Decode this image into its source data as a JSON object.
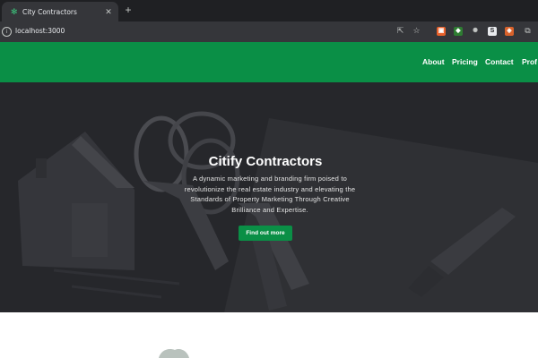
{
  "browser": {
    "tab_title": "City Contractors",
    "url": "localhost:3000",
    "extensions": [
      {
        "name": "extension-orange-icon",
        "color": "#e8612b",
        "glyph": "▣"
      },
      {
        "name": "extension-colorful-icon",
        "color": "#3b7bd6",
        "glyph": "◆"
      },
      {
        "name": "extension-bug-icon",
        "color": "#5f6368",
        "glyph": "✺"
      },
      {
        "name": "extension-s-icon",
        "color": "#ffffff",
        "glyph": "S"
      },
      {
        "name": "extension-fox-icon",
        "color": "#d9622b",
        "glyph": "◈"
      }
    ]
  },
  "nav": {
    "items": [
      "About",
      "Pricing",
      "Contact",
      "Prof"
    ]
  },
  "hero": {
    "title": "Citify Contractors",
    "description": "A dynamic marketing and branding firm poised to revolutionize the real estate industry and elevating the Standards of Property Marketing Through Creative Brilliance and Expertise.",
    "cta_label": "Find out more"
  },
  "colors": {
    "brand_green": "#0a8f46",
    "hero_overlay": "#242428",
    "browser_dark": "#35363a"
  }
}
